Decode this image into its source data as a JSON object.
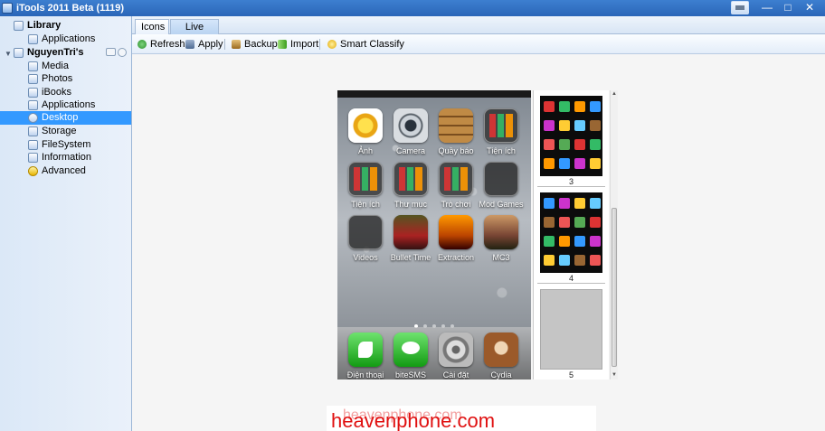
{
  "window": {
    "title": "iTools 2011 Beta (1119)"
  },
  "sidebar": {
    "library": {
      "label": "Library",
      "items": [
        {
          "label": "Applications"
        }
      ]
    },
    "device": {
      "label": "NguyenTri's",
      "items": [
        {
          "label": "Media"
        },
        {
          "label": "Photos"
        },
        {
          "label": "iBooks"
        },
        {
          "label": "Applications"
        },
        {
          "label": "Desktop"
        },
        {
          "label": "Storage"
        },
        {
          "label": "FileSystem"
        },
        {
          "label": "Information"
        },
        {
          "label": "Advanced"
        }
      ],
      "selected": "Desktop"
    }
  },
  "tabs": [
    {
      "label": "Icons"
    },
    {
      "label": "Live Desktop"
    }
  ],
  "toolbar": {
    "refresh": "Refresh",
    "apply": "Apply",
    "backup": "Backup",
    "import": "Import",
    "smart_classify": "Smart Classify"
  },
  "home_screen": {
    "apps": [
      {
        "label": "Ảnh",
        "icon": "photos"
      },
      {
        "label": "Camera",
        "icon": "camera"
      },
      {
        "label": "Quầy báo",
        "icon": "newsstand"
      },
      {
        "label": "Tiện ích",
        "icon": "folder"
      },
      {
        "label": "Tiện ích",
        "icon": "folder"
      },
      {
        "label": "Thư mục",
        "icon": "folder"
      },
      {
        "label": "Trò chơi",
        "icon": "folder"
      },
      {
        "label": "Mod Games",
        "icon": "folder-empty"
      },
      {
        "label": "Videos",
        "icon": "folder-empty"
      },
      {
        "label": "Bullet Time",
        "icon": "game1"
      },
      {
        "label": "Extraction",
        "icon": "game2"
      },
      {
        "label": "MC3",
        "icon": "game3"
      }
    ],
    "dock": [
      {
        "label": "Điện thoại",
        "icon": "phone-app"
      },
      {
        "label": "biteSMS",
        "icon": "sms"
      },
      {
        "label": "Cài đặt",
        "icon": "settings"
      },
      {
        "label": "Cydia",
        "icon": "cydia"
      }
    ],
    "page_count": 5,
    "current_page": 1
  },
  "pages": [
    {
      "number": "3"
    },
    {
      "number": "4"
    },
    {
      "number": "5"
    }
  ],
  "watermark": {
    "text": "heavenphone.com",
    "text_shadow": "heavenphone.com"
  }
}
